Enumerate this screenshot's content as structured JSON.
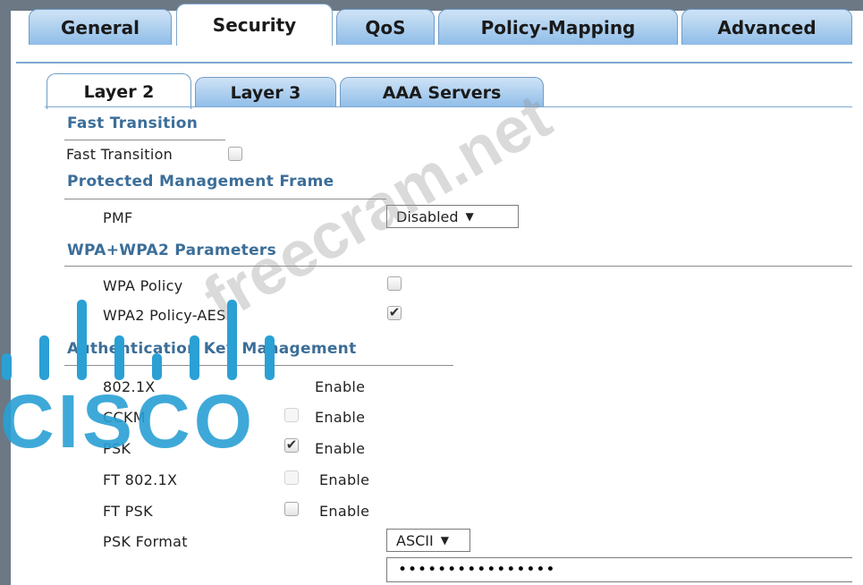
{
  "top_tabs": [
    "General",
    "Security",
    "QoS",
    "Policy-Mapping",
    "Advanced"
  ],
  "active_top_tab": "Security",
  "sub_tabs": [
    "Layer 2",
    "Layer 3",
    "AAA Servers"
  ],
  "active_sub_tab": "Layer 2",
  "fast_transition": {
    "section_title": "Fast Transition",
    "label": "Fast Transition",
    "checked": false
  },
  "pmf": {
    "section_title": "Protected Management Frame",
    "label": "PMF",
    "value": "Disabled"
  },
  "wpa": {
    "section_title": "WPA+WPA2 Parameters",
    "wpa_policy_label": "WPA Policy",
    "wpa_policy_checked": false,
    "wpa2_policy_label": "WPA2 Policy-AES",
    "wpa2_policy_checked": true
  },
  "akm": {
    "section_title": "Authentication Key Management",
    "enable_label": "Enable",
    "items": [
      {
        "label": "802.1X",
        "checked": false
      },
      {
        "label": "CCKM",
        "checked": false
      },
      {
        "label": "PSK",
        "checked": true
      },
      {
        "label": "FT 802.1X",
        "checked": false
      },
      {
        "label": "FT PSK",
        "checked": false
      }
    ],
    "psk_format_label": "PSK Format",
    "psk_format_value": "ASCII",
    "psk_value": "••••••••••••••••"
  },
  "watermark": {
    "site": "freecram.net",
    "logo_text": "CISCO"
  }
}
